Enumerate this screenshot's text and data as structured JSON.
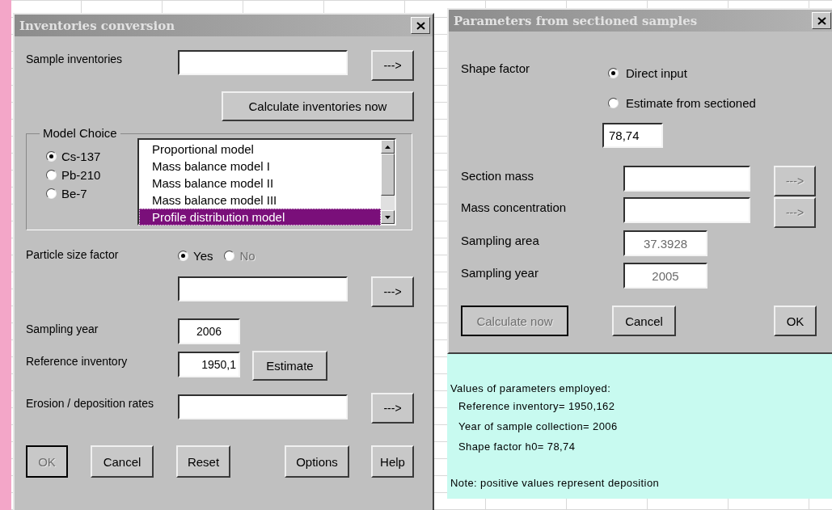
{
  "inventories_dialog": {
    "title": "Inventories conversion",
    "sample_inventories": {
      "label": "Sample inventories",
      "button": "--->"
    },
    "calculate_button": "Calculate inventories now",
    "model_choice": {
      "legend": "Model Choice",
      "isotopes": [
        {
          "label": "Cs-137",
          "selected": true
        },
        {
          "label": "Pb-210",
          "selected": false
        },
        {
          "label": "Be-7",
          "selected": false
        }
      ],
      "models": [
        {
          "label": "Proportional model",
          "selected": false
        },
        {
          "label": "Mass balance model I",
          "selected": false
        },
        {
          "label": "Mass balance model II",
          "selected": false
        },
        {
          "label": "Mass balance model III",
          "selected": false
        },
        {
          "label": "Profile distribution model",
          "selected": true
        }
      ]
    },
    "particle_size_factor": {
      "label": "Particle size factor",
      "options": [
        {
          "label": "Yes",
          "selected": true,
          "disabled": false
        },
        {
          "label": "No",
          "selected": false,
          "disabled": true
        }
      ],
      "button": "--->"
    },
    "sampling_year": {
      "label": "Sampling year",
      "value": "2006"
    },
    "reference_inventory": {
      "label": "Reference inventory",
      "value": "1950,1",
      "button": "Estimate"
    },
    "erosion_deposition": {
      "label": "Erosion / deposition rates",
      "button": "--->"
    },
    "buttons": [
      {
        "label": "OK",
        "disabled": true,
        "default": true
      },
      {
        "label": "Cancel",
        "disabled": false,
        "default": false
      },
      {
        "label": "Reset",
        "disabled": false,
        "default": false
      },
      {
        "label": "Options",
        "disabled": false,
        "default": false
      },
      {
        "label": "Help",
        "disabled": false,
        "default": false
      }
    ]
  },
  "sectioned_dialog": {
    "title": "Parameters from sectioned samples",
    "shape_factor": {
      "label": "Shape factor",
      "options": [
        {
          "label": "Direct input",
          "selected": true
        },
        {
          "label": "Estimate from sectioned",
          "selected": false
        }
      ],
      "value": "78,74"
    },
    "fields": [
      {
        "label": "Section mass",
        "disabled": false,
        "button": "--->",
        "button_disabled": true
      },
      {
        "label": "Mass concentration",
        "disabled": false,
        "button": "--->",
        "button_disabled": true
      },
      {
        "label": "Sampling area",
        "value": "37.3928",
        "disabled": true
      },
      {
        "label": "Sampling year",
        "value": "2005",
        "disabled": true
      }
    ],
    "buttons": [
      {
        "label": "Calculate now",
        "disabled": true,
        "default": true
      },
      {
        "label": "Cancel",
        "disabled": false,
        "default": false
      },
      {
        "label": "OK",
        "disabled": false,
        "default": false
      }
    ]
  },
  "notes": {
    "heading": "Values of parameters employed:",
    "lines": [
      "Reference inventory= 1950,162",
      "Year of sample collection= 2006",
      "Shape factor h0= 78,74"
    ],
    "footer": "Note: positive values represent deposition"
  }
}
